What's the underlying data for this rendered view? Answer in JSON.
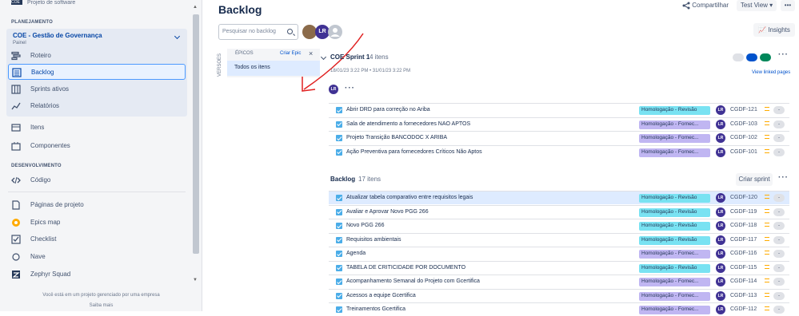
{
  "sidebar": {
    "project_type": "Projeto de software",
    "logo_text": "COE",
    "planning_label": "PLANEJAMENTO",
    "project_name": "COE - Gestão de Governança",
    "project_sub": "Painel",
    "planning_items": [
      {
        "label": "Roteiro",
        "icon": "roadmap-icon"
      },
      {
        "label": "Backlog",
        "icon": "backlog-icon"
      },
      {
        "label": "Sprints ativos",
        "icon": "board-icon"
      },
      {
        "label": "Relatórios",
        "icon": "reports-icon"
      }
    ],
    "mid_items": [
      {
        "label": "Itens",
        "icon": "issues-icon"
      },
      {
        "label": "Componentes",
        "icon": "components-icon"
      }
    ],
    "dev_label": "DESENVOLVIMENTO",
    "code_label": "Código",
    "bottom_items": [
      {
        "label": "Páginas de projeto",
        "icon": "pages-icon"
      },
      {
        "label": "Epics map",
        "icon": "epics-map-icon"
      },
      {
        "label": "Checklist",
        "icon": "checklist-icon"
      },
      {
        "label": "Nave",
        "icon": "nave-icon"
      },
      {
        "label": "Zephyr Squad",
        "icon": "zephyr-icon"
      }
    ],
    "footer_text": "Você está em um projeto gerenciado por uma empresa",
    "footer_link": "Saiba mais"
  },
  "header": {
    "title": "Backlog",
    "share_label": "Compartilhar",
    "view_label": "Test View",
    "more_label": "•••",
    "insights_label": "Insights"
  },
  "search": {
    "placeholder": "Pesquisar no backlog"
  },
  "avatars": [
    {
      "initials": "",
      "color": "#8b6b4a"
    },
    {
      "initials": "LR",
      "color": "#403294"
    },
    {
      "initials": "",
      "color": "#97a0af"
    }
  ],
  "epics": {
    "versions_label": "VERSÕES",
    "header": "ÉPICOS",
    "create_label": "Criar Epic",
    "all_items": "Todos os itens"
  },
  "sprint": {
    "title": "COE Sprint 1",
    "count": "4 itens",
    "dates": "18/01/23 3:22 PM • 31/01/23 3:22 PM",
    "view_linked": "View linked pages",
    "assignee_initials": "LR",
    "status_colors": [
      "#dfe1e6",
      "#0052cc",
      "#00875a"
    ],
    "rows": [
      {
        "summary": "Abrir DRD para correção no Ariba",
        "tag": "Homologação - Revisão",
        "tag_color": "#79e2f2",
        "key": "CGDF-121",
        "est": "-"
      },
      {
        "summary": "Sala de atendimento a fornecedores NAO APTOS",
        "tag": "Homologação - Fornec...",
        "tag_color": "#c0b6f2",
        "key": "CGDF-103",
        "est": "-"
      },
      {
        "summary": "Projeto Transição BANCODOC X ARIBA",
        "tag": "Homologação - Fornec...",
        "tag_color": "#c0b6f2",
        "key": "CGDF-102",
        "est": "-"
      },
      {
        "summary": "Ação Preventiva para fornecedores Críticos Não Aptos",
        "tag": "Homologação - Fornec...",
        "tag_color": "#c0b6f2",
        "key": "CGDF-101",
        "est": "-"
      }
    ]
  },
  "backlog": {
    "title": "Backlog",
    "count": "17 itens",
    "create_sprint": "Criar sprint",
    "rows": [
      {
        "summary": "Atualizar tabela comparativo entre requisitos legais",
        "tag": "Homologação - Revisão",
        "tag_color": "#79e2f2",
        "key": "CGDF-120",
        "est": "-"
      },
      {
        "summary": "Avaliar e Aprovar Novo PGG 266",
        "tag": "Homologação - Revisão",
        "tag_color": "#79e2f2",
        "key": "CGDF-119",
        "est": "-"
      },
      {
        "summary": "Novo PGG 266",
        "tag": "Homologação - Revisão",
        "tag_color": "#79e2f2",
        "key": "CGDF-118",
        "est": "-"
      },
      {
        "summary": "Requisitos ambientais",
        "tag": "Homologação - Revisão",
        "tag_color": "#79e2f2",
        "key": "CGDF-117",
        "est": "-"
      },
      {
        "summary": "Agenda",
        "tag": "Homologação - Fornec...",
        "tag_color": "#c0b6f2",
        "key": "CGDF-116",
        "est": "-"
      },
      {
        "summary": "TABELA DE CRITICIDADE POR DOCUMENTO",
        "tag": "Homologação - Revisão",
        "tag_color": "#79e2f2",
        "key": "CGDF-115",
        "est": "-"
      },
      {
        "summary": "Acompanhamento Semanal do Projeto com Gcertifica",
        "tag": "Homologação - Fornec...",
        "tag_color": "#c0b6f2",
        "key": "CGDF-114",
        "est": "-"
      },
      {
        "summary": "Acessos a equipe Gcertifica",
        "tag": "Homologação - Fornec...",
        "tag_color": "#c0b6f2",
        "key": "CGDF-113",
        "est": "-"
      },
      {
        "summary": "Treinamentos Gcertifica",
        "tag": "Homologação - Fornec...",
        "tag_color": "#c0b6f2",
        "key": "CGDF-112",
        "est": "-"
      }
    ]
  }
}
